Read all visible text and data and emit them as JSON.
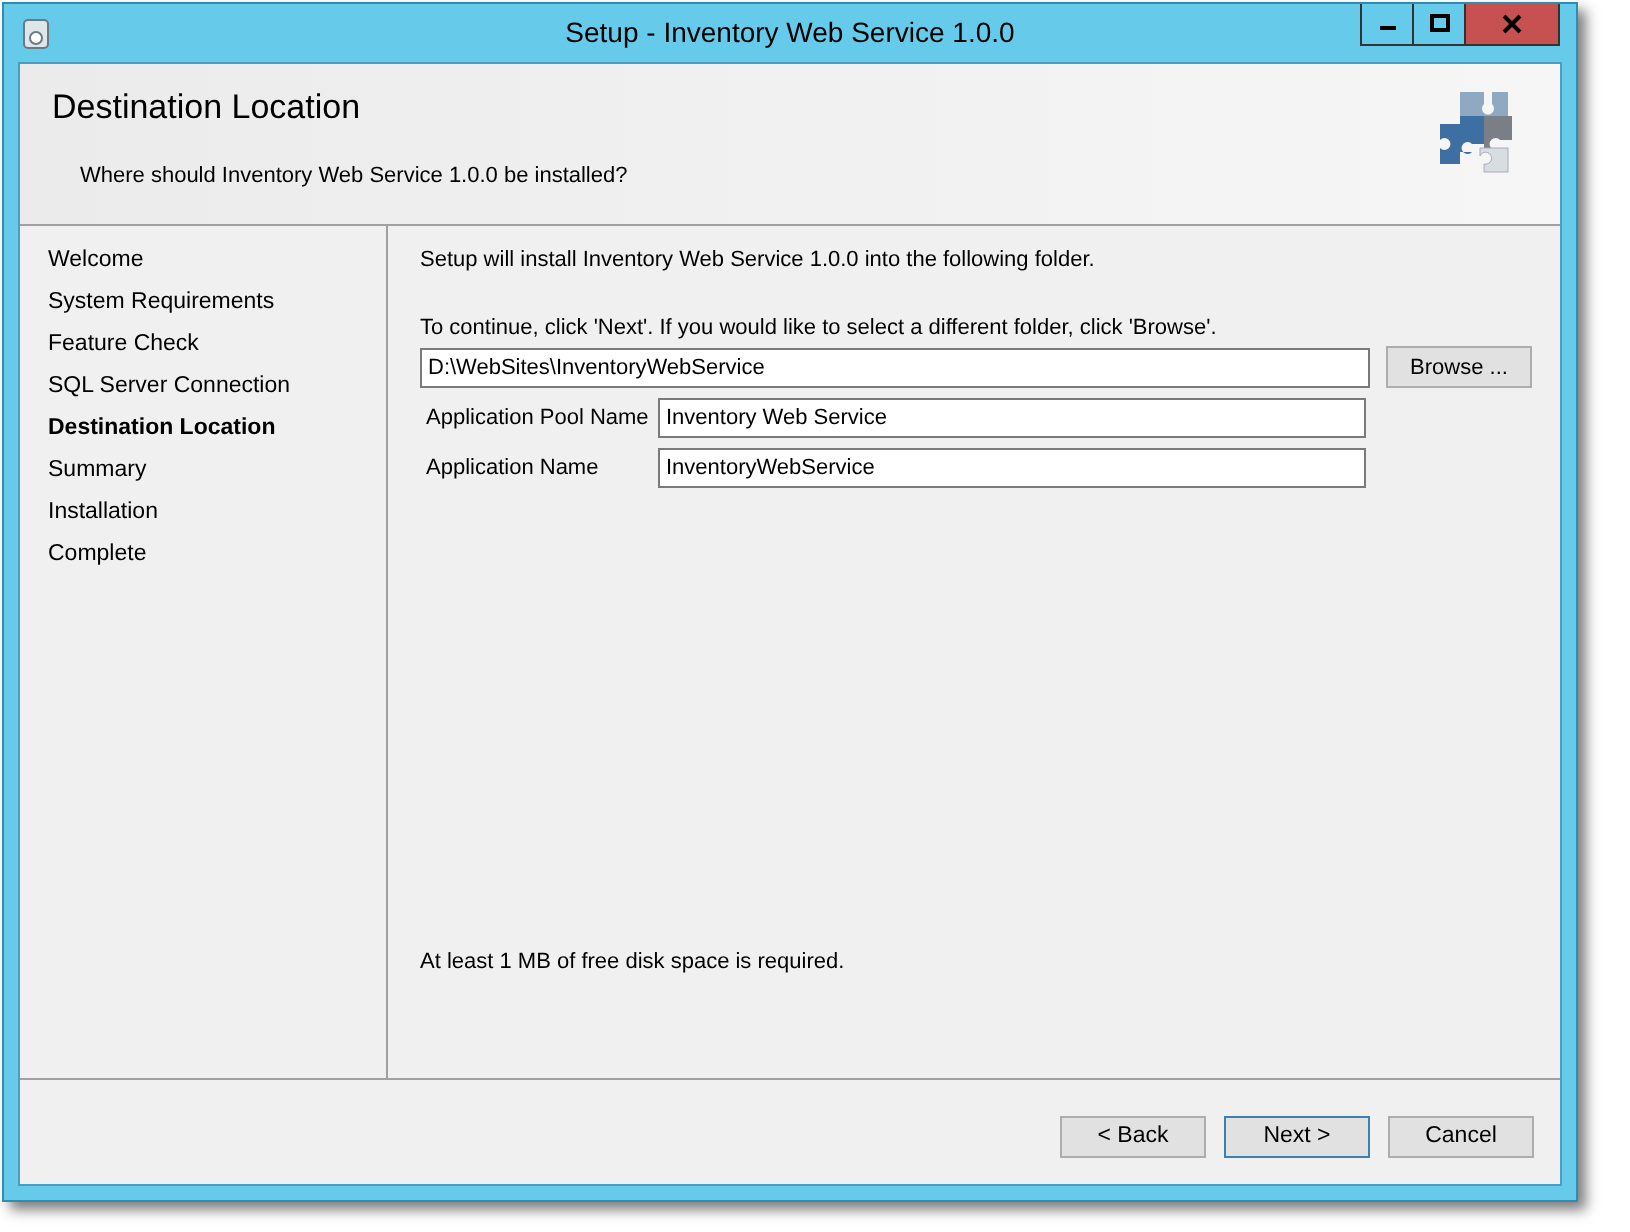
{
  "window": {
    "title": "Setup - Inventory Web Service 1.0.0"
  },
  "header": {
    "title": "Destination Location",
    "subtitle": "Where should Inventory Web Service 1.0.0 be installed?"
  },
  "steps": [
    {
      "label": "Welcome",
      "selected": false
    },
    {
      "label": "System Requirements",
      "selected": false
    },
    {
      "label": "Feature Check",
      "selected": false
    },
    {
      "label": "SQL Server Connection",
      "selected": false
    },
    {
      "label": "Destination Location",
      "selected": true
    },
    {
      "label": "Summary",
      "selected": false
    },
    {
      "label": "Installation",
      "selected": false
    },
    {
      "label": "Complete",
      "selected": false
    }
  ],
  "intro": "Setup will install Inventory Web Service 1.0.0 into the following folder.",
  "instruction": "To continue, click 'Next'. If you would like to select a different folder, click 'Browse'.",
  "folder": {
    "value": "D:\\WebSites\\InventoryWebService",
    "button": "Browse ..."
  },
  "fields": [
    {
      "label": "Application Pool Name",
      "value": "Inventory Web Service"
    },
    {
      "label": "Application Name",
      "value": "InventoryWebService"
    }
  ],
  "disk_note": "At least 1 MB of free disk space is required.",
  "buttons": [
    {
      "label": "< Back",
      "default": false
    },
    {
      "label": "Next >",
      "default": true
    },
    {
      "label": "Cancel",
      "default": false
    }
  ]
}
